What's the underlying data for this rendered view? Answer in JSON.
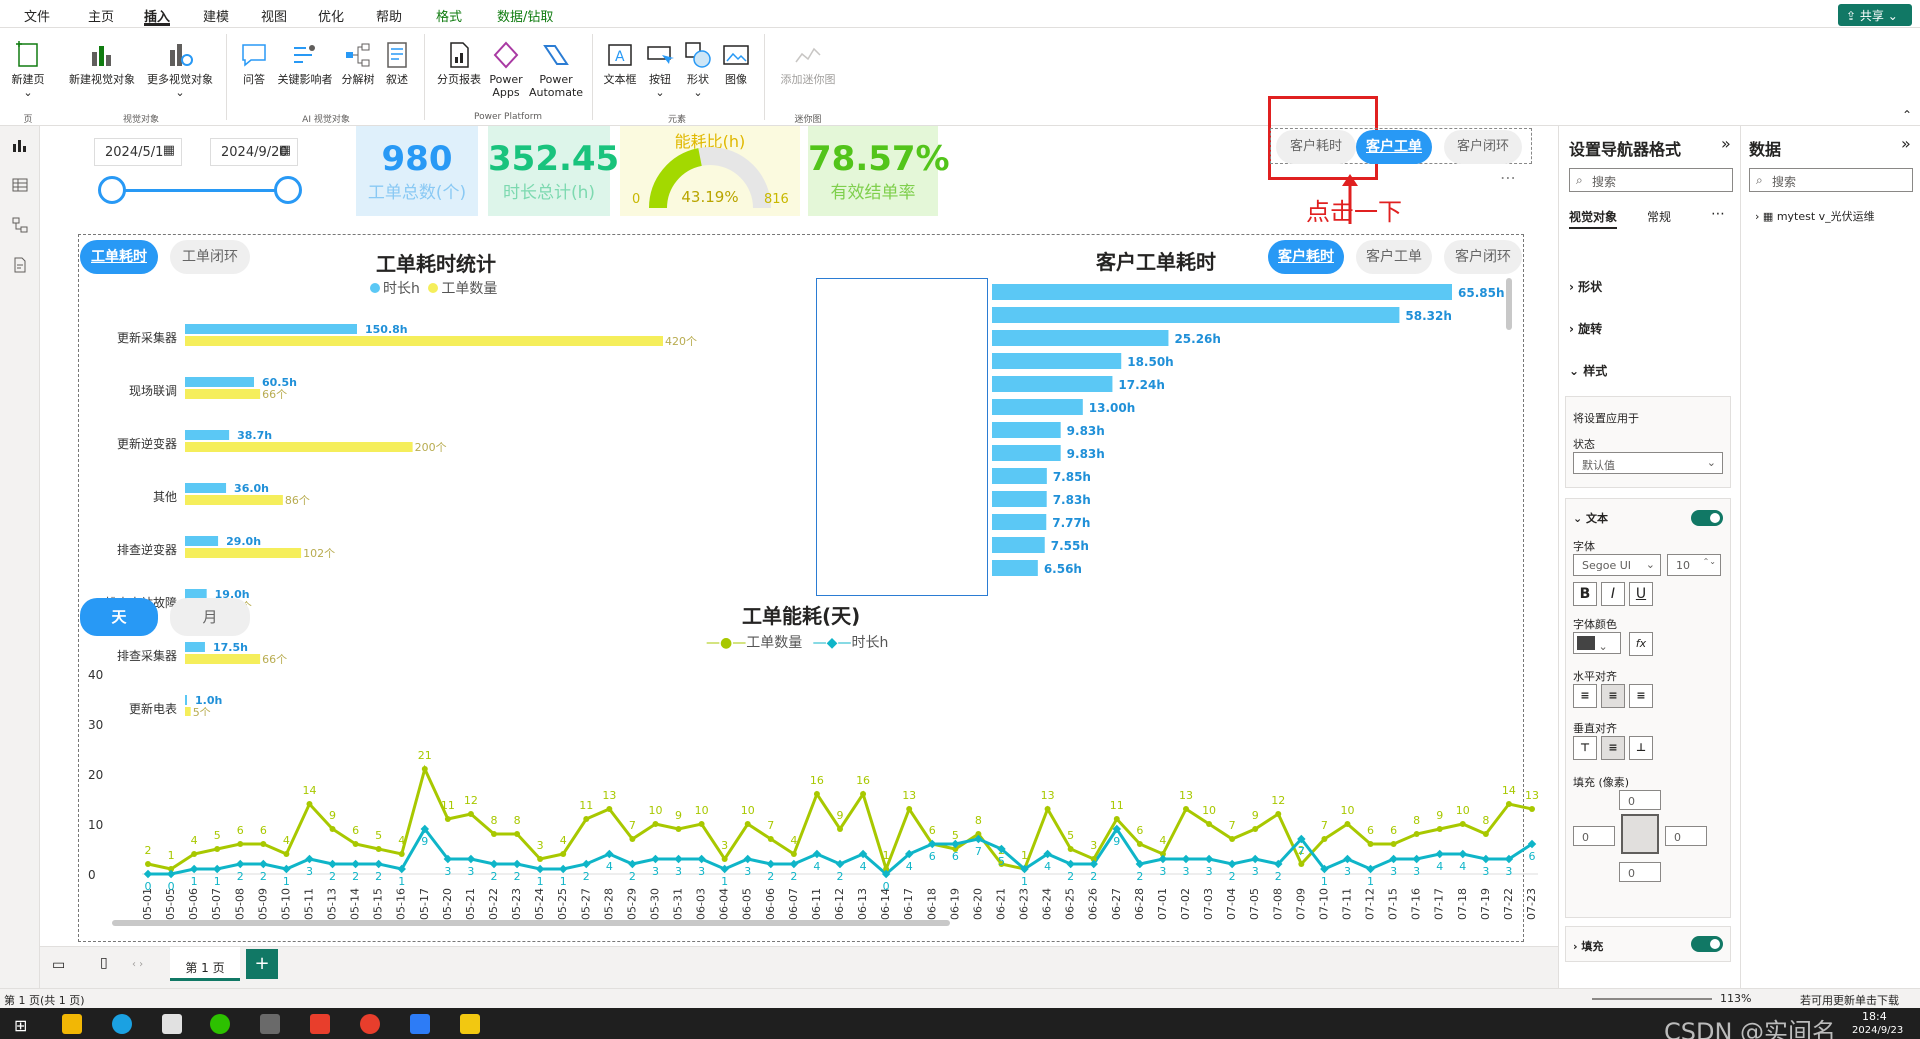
{
  "menu": [
    "文件",
    "主页",
    "插入",
    "建模",
    "视图",
    "优化",
    "帮助",
    "格式",
    "数据/钻取"
  ],
  "share": "共享",
  "ribbon": {
    "buttons": [
      "新建页",
      "新建视觉对象",
      "更多视觉对象",
      "问答",
      "关键影响者",
      "分解树",
      "叙述",
      "分页报表",
      "Power Apps",
      "Power Automate",
      "文本框",
      "按钮",
      "形状",
      "图像",
      "添加迷你图"
    ],
    "groups": [
      "页",
      "视觉对象",
      "AI 视觉对象",
      "Power Platform",
      "元素",
      "迷你图"
    ]
  },
  "filters": {
    "start": "2024/5/1",
    "end": "2024/9/20"
  },
  "kpis": [
    {
      "value": "980",
      "label": "工单总数(个)",
      "color": "#2899f5",
      "bg": "#dff0fb"
    },
    {
      "value": "352.45",
      "label": "时长总计(h)",
      "color": "#19c37d",
      "bg": "#ddf5ea"
    },
    {
      "value": "78.57%",
      "label": "有效结单率",
      "color": "#52c41a",
      "bg": "#e4f7d8"
    }
  ],
  "gauge": {
    "title": "能耗比(h)",
    "value": "43.19%",
    "min": "0",
    "max": "816"
  },
  "nav_top": [
    "客户耗时",
    "客户工单",
    "客户闭环"
  ],
  "annotation": "点击一下",
  "chart1": {
    "title": "工单耗时统计",
    "legend": [
      "时长h",
      "工单数量"
    ],
    "tabs": [
      "工单耗时",
      "工单闭环"
    ],
    "categories": [
      "更新采集器",
      "现场联调",
      "更新逆变器",
      "其他",
      "排查逆变器",
      "排查电站故障",
      "排查采集器",
      "更新电表"
    ],
    "hours": [
      150.8,
      60.5,
      38.7,
      36.0,
      29.0,
      19.0,
      17.5,
      1.0
    ],
    "hour_labels": [
      "150.8h",
      "60.5h",
      "38.7h",
      "36.0h",
      "29.0h",
      "19.0h",
      "17.5h",
      "1.0h"
    ],
    "counts": [
      420,
      66,
      200,
      86,
      102,
      35,
      66,
      5
    ],
    "count_labels": [
      "420个",
      "66个",
      "200个",
      "86个",
      "102个",
      "35个",
      "66个",
      "5个"
    ]
  },
  "chart2": {
    "title": "客户工单耗时",
    "tabs": [
      "客户耗时",
      "客户工单",
      "客户闭环"
    ],
    "values": [
      65.85,
      58.32,
      25.26,
      18.5,
      17.24,
      13.0,
      9.83,
      9.83,
      7.85,
      7.83,
      7.77,
      7.55,
      6.56
    ],
    "labels": [
      "65.85h",
      "58.32h",
      "25.26h",
      "18.50h",
      "17.24h",
      "13.00h",
      "9.83h",
      "9.83h",
      "7.85h",
      "7.83h",
      "7.77h",
      "7.55h",
      "6.56h"
    ]
  },
  "chart3": {
    "title": "工单能耗(天)",
    "legend": [
      "工单数量",
      "时长h"
    ],
    "tabs": [
      "天",
      "月"
    ],
    "y_ticks": [
      "40",
      "30",
      "20",
      "10",
      "0"
    ],
    "dates": [
      "05-01",
      "05-05",
      "05-06",
      "05-07",
      "05-08",
      "05-09",
      "05-10",
      "05-11",
      "05-13",
      "05-14",
      "05-15",
      "05-16",
      "05-17",
      "05-20",
      "05-21",
      "05-22",
      "05-23",
      "05-24",
      "05-25",
      "05-27",
      "05-28",
      "05-29",
      "05-30",
      "05-31",
      "06-03",
      "06-04",
      "06-05",
      "06-06",
      "06-07",
      "06-11",
      "06-12",
      "06-13",
      "06-14",
      "06-17",
      "06-18",
      "06-19",
      "06-20",
      "06-21",
      "06-23",
      "06-24",
      "06-25",
      "06-26",
      "06-27",
      "06-28",
      "07-01",
      "07-02",
      "07-03",
      "07-04",
      "07-05",
      "07-08",
      "07-09",
      "07-10",
      "07-11",
      "07-12",
      "07-15",
      "07-16",
      "07-17",
      "07-18",
      "07-19",
      "07-22",
      "07-23"
    ],
    "counts": [
      2,
      1,
      4,
      5,
      6,
      6,
      4,
      14,
      9,
      6,
      5,
      4,
      21,
      11,
      12,
      8,
      8,
      3,
      4,
      11,
      13,
      7,
      10,
      9,
      10,
      3,
      10,
      7,
      4,
      16,
      9,
      16,
      1,
      13,
      6,
      5,
      8,
      2,
      1,
      13,
      5,
      3,
      11,
      6,
      4,
      13,
      10,
      7,
      9,
      12,
      2,
      7,
      10,
      6,
      6,
      8,
      9,
      10,
      8,
      14,
      13
    ],
    "hours": [
      0,
      0,
      1,
      1,
      2,
      2,
      1,
      3,
      2,
      2,
      2,
      1,
      9,
      3,
      3,
      2,
      2,
      1,
      1,
      2,
      4,
      2,
      3,
      3,
      3,
      1,
      3,
      2,
      2,
      4,
      2,
      4,
      0,
      4,
      6,
      6,
      7,
      5,
      1,
      4,
      2,
      2,
      9,
      2,
      3,
      3,
      3,
      2,
      3,
      2,
      7,
      1,
      3,
      1,
      3,
      3,
      4,
      4,
      3,
      3,
      6
    ]
  },
  "format_pane": {
    "title": "设置导航器格式",
    "search": "搜索",
    "tabs": [
      "视觉对象",
      "常规"
    ],
    "sections": [
      "形状",
      "旋转",
      "样式"
    ],
    "apply_to": "将设置应用于",
    "state_label": "状态",
    "state_value": "默认值",
    "text_section": "文本",
    "font_label": "字体",
    "font": "Segoe UI",
    "size": "10",
    "font_color": "字体颜色",
    "halign": "水平对齐",
    "valign": "垂直对齐",
    "padding": "填充 (像素)",
    "pad_value": "0",
    "fill": "填充"
  },
  "data_pane": {
    "title": "数据",
    "search": "搜索",
    "table": "mytest v_光伏运维"
  },
  "page_tab": "第 1 页",
  "status": {
    "left": "第 1 页(共 1 页)",
    "zoom": "113%",
    "right": "若可用更新单击下载",
    "watermark": "CSDN @实间名",
    "time": "18:4",
    "date": "2024/9/23"
  }
}
